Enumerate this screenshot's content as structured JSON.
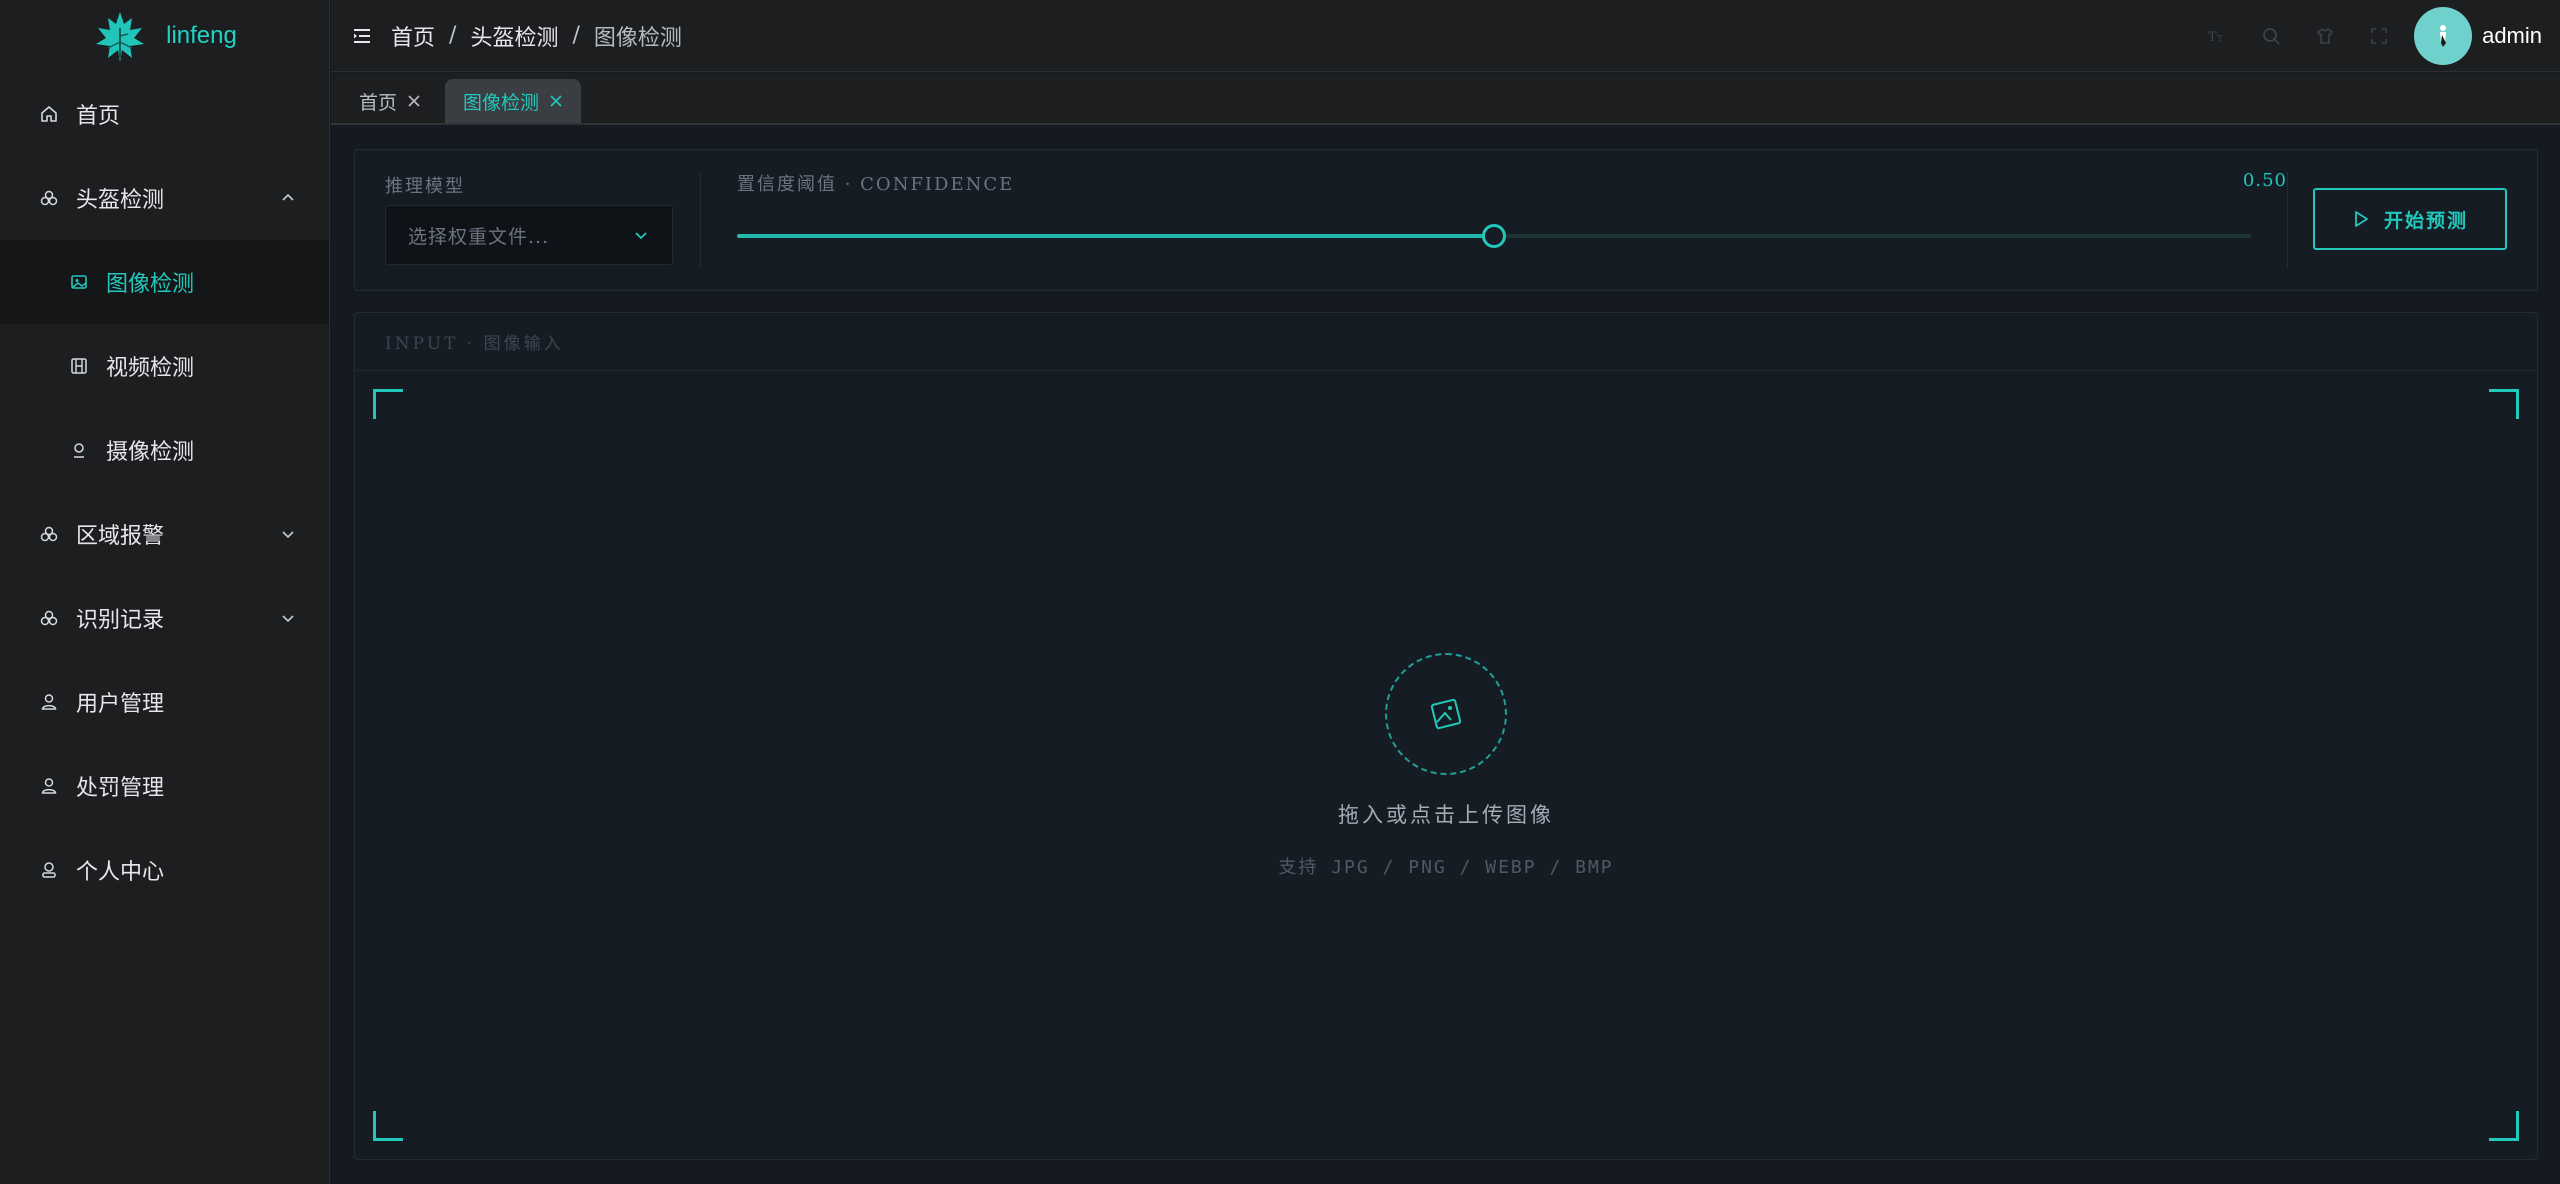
{
  "app": {
    "name": "linfeng"
  },
  "sidebar": {
    "items": [
      {
        "label": "首页",
        "icon": "home-icon"
      },
      {
        "label": "头盔检测",
        "icon": "helmet-icon",
        "expanded": true,
        "children": [
          {
            "label": "图像检测",
            "icon": "image-icon",
            "active": true
          },
          {
            "label": "视频检测",
            "icon": "video-icon"
          },
          {
            "label": "摄像检测",
            "icon": "camera-icon"
          }
        ]
      },
      {
        "label": "区域报警",
        "icon": "helmet-icon",
        "expanded": false
      },
      {
        "label": "识别记录",
        "icon": "helmet-icon",
        "expanded": false
      },
      {
        "label": "用户管理",
        "icon": "user-icon"
      },
      {
        "label": "处罚管理",
        "icon": "user-icon"
      },
      {
        "label": "个人中心",
        "icon": "person-icon"
      }
    ]
  },
  "header": {
    "breadcrumb": [
      "首页",
      "头盔检测",
      "图像检测"
    ],
    "separator": "/",
    "username": "admin"
  },
  "tabs": [
    {
      "label": "首页",
      "active": false
    },
    {
      "label": "图像检测",
      "active": true
    }
  ],
  "controls": {
    "model_label": "推理模型",
    "model_placeholder": "选择权重文件...",
    "confidence_label": "置信度阈值 · CONFIDENCE",
    "confidence_value": "0.50",
    "confidence_fraction": 0.5,
    "start_button": "开始预测"
  },
  "input": {
    "header": "INPUT · 图像输入",
    "title": "拖入或点击上传图像",
    "formats": "支持 JPG / PNG / WEBP / BMP"
  },
  "colors": {
    "accent": "#22c8bb",
    "background": "#151a21",
    "sidebar": "#1d1e1f"
  }
}
